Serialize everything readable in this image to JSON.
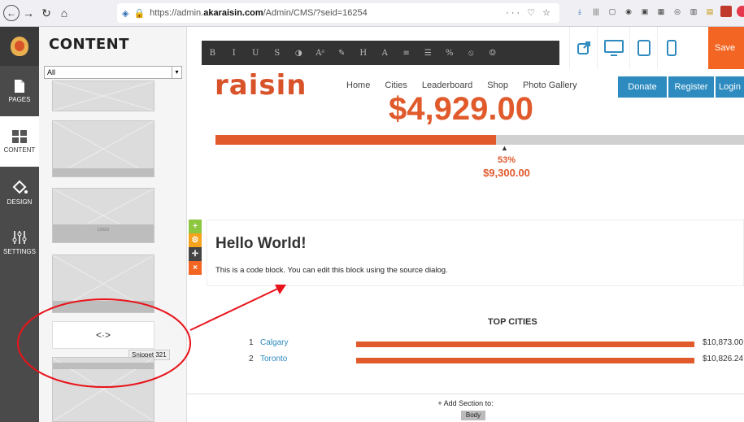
{
  "browser": {
    "url_prefix": "https://admin.",
    "url_host": "akaraisin.com",
    "url_path": "/Admin/CMS/?seid=16254",
    "url_icons": "··· ♡ ☆"
  },
  "left_rail": {
    "items": [
      {
        "label": "PAGES",
        "icon": "page-icon"
      },
      {
        "label": "CONTENT",
        "icon": "grid-icon"
      },
      {
        "label": "DESIGN",
        "icon": "paint-bucket-icon"
      },
      {
        "label": "SETTINGS",
        "icon": "sliders-icon"
      }
    ]
  },
  "content_panel": {
    "title": "CONTENT",
    "filter_value": "All",
    "snippet_icon": "<·>",
    "snippet_tooltip": "Snippet 321",
    "logo_label": "LOGO"
  },
  "toolbar": {
    "buttons": [
      "B",
      "I",
      "U",
      "S",
      "◑",
      "Aᵃ",
      "✎",
      "H",
      "A",
      "≡",
      "☰",
      "%",
      "⦸",
      "☺"
    ],
    "save_label": "Save"
  },
  "site": {
    "logo": "raisin",
    "nav": [
      "Home",
      "Cities",
      "Leaderboard",
      "Shop",
      "Photo Gallery"
    ],
    "donate": "Donate",
    "register": "Register",
    "login": "Login",
    "raised_amount": "$4,929.00",
    "progress_percent": 53,
    "percent_label": "53%",
    "goal_amount": "$9,300.00",
    "code_block": {
      "heading": "Hello World!",
      "text": "This is a code block. You can edit this block using the source dialog."
    },
    "top_cities": {
      "title": "TOP CITIES",
      "rows": [
        {
          "rank": "1",
          "name": "Calgary",
          "amount": "$10,873.00"
        },
        {
          "rank": "2",
          "name": "Toronto",
          "amount": "$10,826.24"
        }
      ]
    },
    "add_section_label": "+ Add Section to:",
    "body_button": "Body"
  },
  "colors": {
    "accent": "#e05a2b",
    "link": "#2e8bc0",
    "annotation": "#e8141b"
  }
}
